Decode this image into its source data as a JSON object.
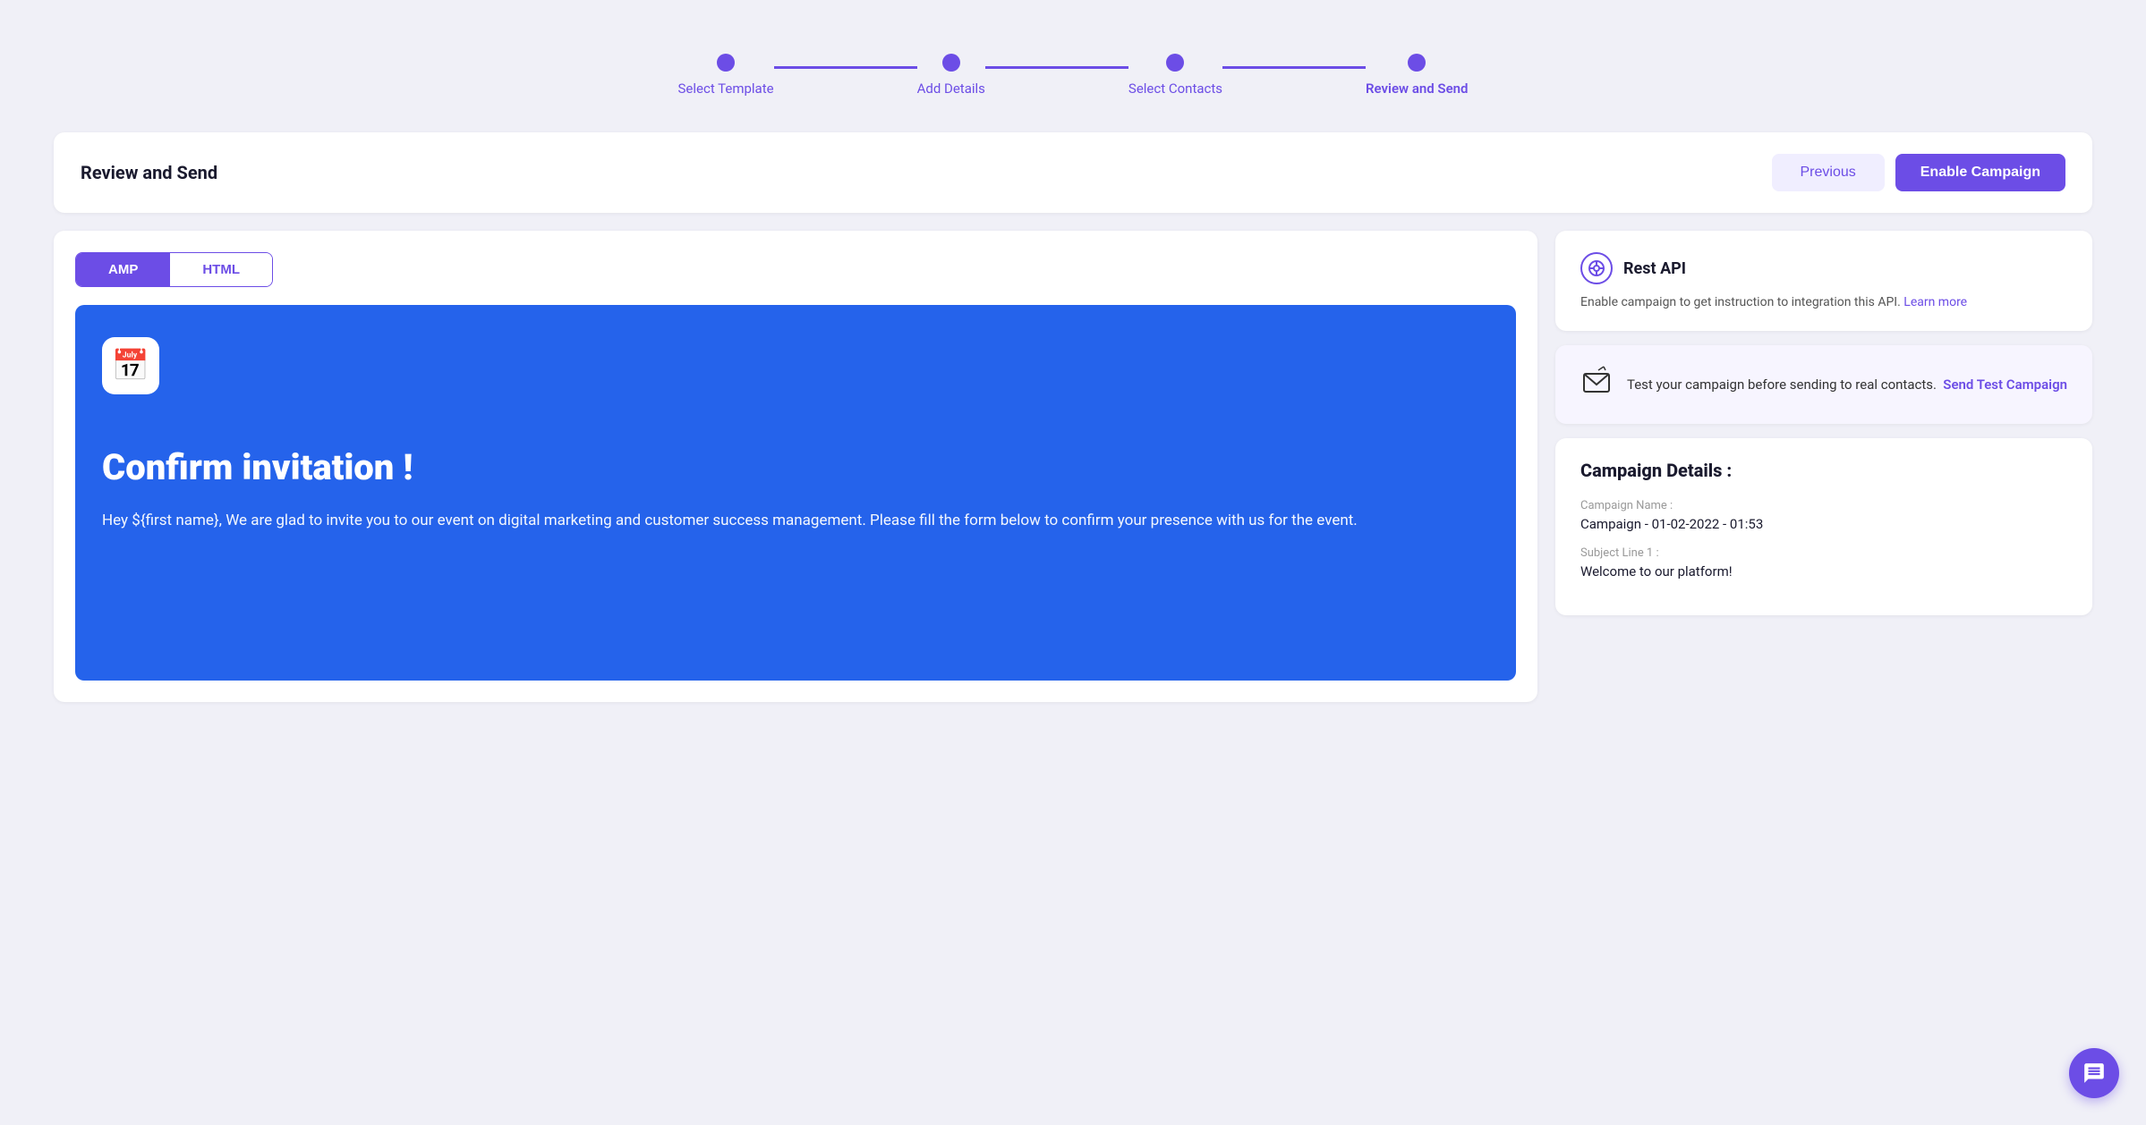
{
  "stepper": {
    "steps": [
      {
        "label": "Select Template",
        "active": true
      },
      {
        "label": "Add Details",
        "active": true
      },
      {
        "label": "Select Contacts",
        "active": true
      },
      {
        "label": "Review and Send",
        "active": true,
        "current": true
      }
    ]
  },
  "header": {
    "title": "Review and Send",
    "previous_label": "Previous",
    "enable_label": "Enable Campaign"
  },
  "tabs": {
    "amp_label": "AMP",
    "html_label": "HTML",
    "active": "AMP"
  },
  "email_preview": {
    "title": "Confirm invitation !",
    "body": "Hey ${first name}, We are glad to invite you to our event on digital marketing and customer success management. Please fill the form below to confirm your presence with us for the event."
  },
  "rest_api": {
    "title": "Rest API",
    "description": "Enable campaign to get instruction to integration this API.",
    "learn_more": "Learn more"
  },
  "test_campaign": {
    "text": "Test your campaign before sending to real contacts.",
    "send_test_label": "Send Test Campaign"
  },
  "campaign_details": {
    "title": "Campaign Details :",
    "name_label": "Campaign Name :",
    "name_value": "Campaign - 01-02-2022 - 01:53",
    "subject_label": "Subject Line 1 :",
    "subject_value": "Welcome to our platform!"
  }
}
